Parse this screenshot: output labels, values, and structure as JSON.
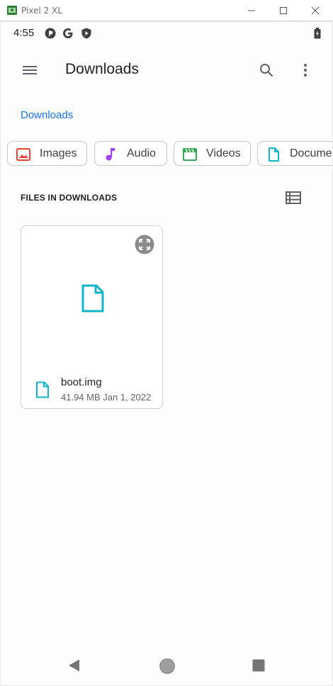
{
  "window": {
    "title": "Pixel 2 XL"
  },
  "statusbar": {
    "time": "4:55"
  },
  "appbar": {
    "title": "Downloads"
  },
  "breadcrumb": {
    "label": "Downloads"
  },
  "chips": [
    {
      "label": "Images",
      "icon": "image-icon",
      "color": "#ea4335"
    },
    {
      "label": "Audio",
      "icon": "music-note-icon",
      "color": "#a142f4"
    },
    {
      "label": "Videos",
      "icon": "movie-icon",
      "color": "#34a853"
    },
    {
      "label": "Documents",
      "icon": "document-icon",
      "color": "#12b5cb"
    }
  ],
  "section": {
    "title": "FILES IN DOWNLOADS"
  },
  "files": [
    {
      "name": "boot.img",
      "meta": "41.94 MB Jan 1, 2022",
      "icon": "file-icon",
      "color": "#12b5cb"
    }
  ],
  "colors": {
    "accent": "#1a73e8",
    "file": "#12b5cb"
  }
}
